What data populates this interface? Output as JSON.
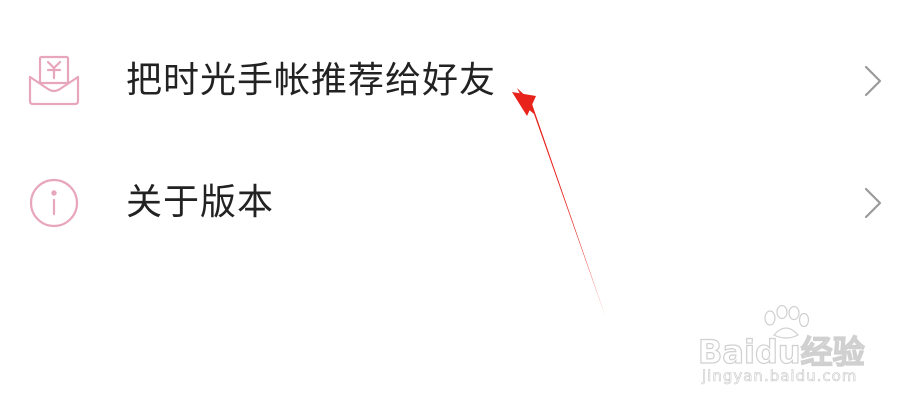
{
  "menu": {
    "items": [
      {
        "label": "把时光手帐推荐给好友",
        "icon": "red-envelope-yuan-icon"
      },
      {
        "label": "关于版本",
        "icon": "info-circle-icon"
      }
    ]
  },
  "watermark": {
    "brand": "Baidu经验",
    "url": "jingyan.baidu.com"
  },
  "colors": {
    "icon_stroke": "#e8a6bc",
    "label": "#222222",
    "chevron": "#9a9a9a",
    "annotation_arrow": "#e8231c"
  }
}
